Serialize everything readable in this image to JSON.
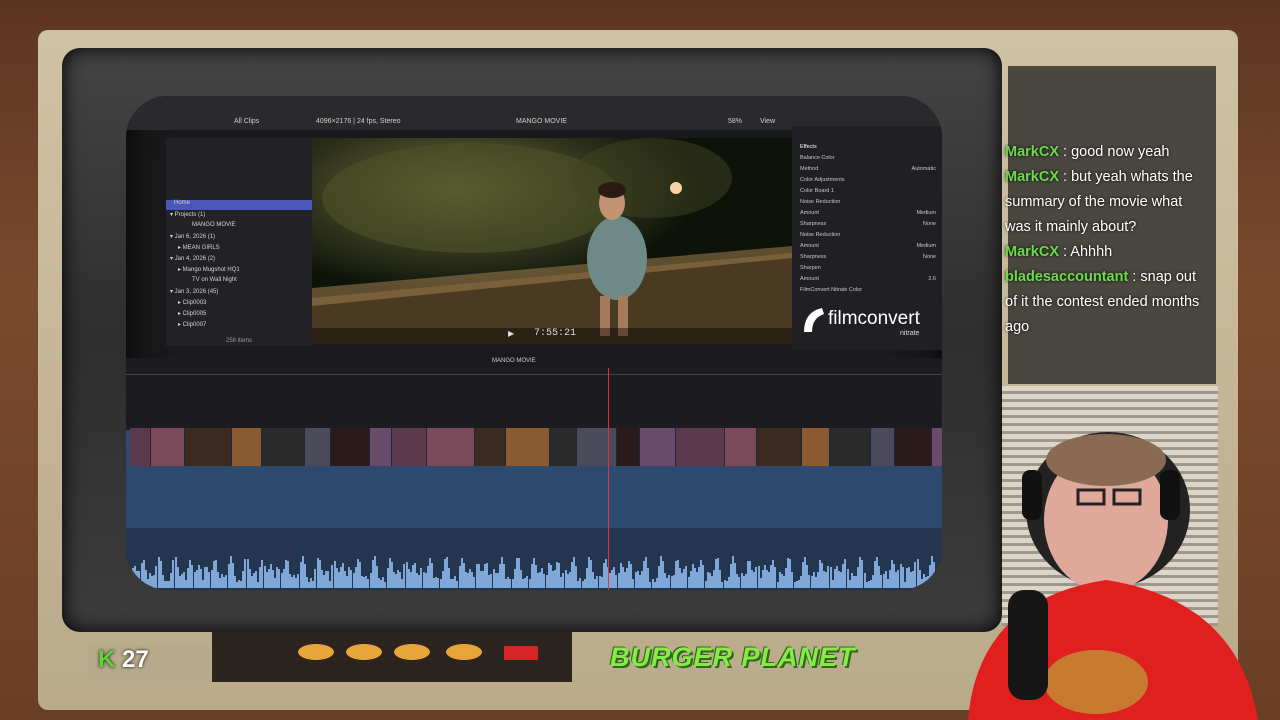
{
  "fcp": {
    "toolbar": {
      "all_clips": "All Clips",
      "format": "4096×2176 | 24 fps, Stereo",
      "project_title": "MANGO MOVIE",
      "zoom": "58%",
      "view": "View"
    },
    "sidebar": {
      "items": [
        {
          "label": "Home"
        },
        {
          "label": "▾ Projects (1)"
        },
        {
          "label": "MANGO MOVIE"
        },
        {
          "label": "▾ Jan 6, 2026 (1)"
        },
        {
          "label": "▸ MEAN GIRLS"
        },
        {
          "label": "▾ Jan 4, 2026 (2)"
        },
        {
          "label": "▸ Mango Mugshot HQ1"
        },
        {
          "label": "TV on Wall Night"
        },
        {
          "label": "▾ Jan 3, 2026 (45)"
        },
        {
          "label": "▸ Clip0003"
        },
        {
          "label": "▸ Clip0005"
        },
        {
          "label": "▸ Clip0007"
        }
      ],
      "item_count": "258 items"
    },
    "viewer": {
      "timecode": "7:55:21"
    },
    "inspector": {
      "rows": [
        {
          "label": "Effects"
        },
        {
          "label": "Balance Color"
        },
        {
          "label": "Method",
          "value": "Automatic"
        },
        {
          "label": "Color Adjustments"
        },
        {
          "label": "Color Board 1"
        },
        {
          "label": "Noise Reduction"
        },
        {
          "label": "Amount",
          "value": "Medium"
        },
        {
          "label": "Sharpness",
          "value": "None"
        },
        {
          "label": "Noise Reduction"
        },
        {
          "label": "Amount",
          "value": "Medium"
        },
        {
          "label": "Sharpness",
          "value": "None"
        },
        {
          "label": "Sharpen"
        },
        {
          "label": "Amount",
          "value": "2.6"
        },
        {
          "label": "FilmConvert Nitrate Color"
        }
      ],
      "brand_main": "filmconvert",
      "brand_sub": "nitrate"
    },
    "timeline": {
      "project_label": "MANGO MOVIE"
    }
  },
  "chat": {
    "messages": [
      {
        "user": "MarkCX",
        "text": "good now yeah"
      },
      {
        "user": "MarkCX",
        "text": "but yeah whats the summary of the movie what was it mainly about?"
      },
      {
        "user": "MarkCX",
        "text": "Ahhhh"
      },
      {
        "user": "bladesaccountant",
        "text": "snap out of it the contest ended months ago"
      }
    ]
  },
  "overlay": {
    "k_letter": "K",
    "k_count": "27",
    "brand": "BURGER PLANET"
  },
  "colors": {
    "chat_user": "#6adc4a",
    "brand_green": "#88e94c",
    "fcp_selection": "#4a56b8"
  }
}
